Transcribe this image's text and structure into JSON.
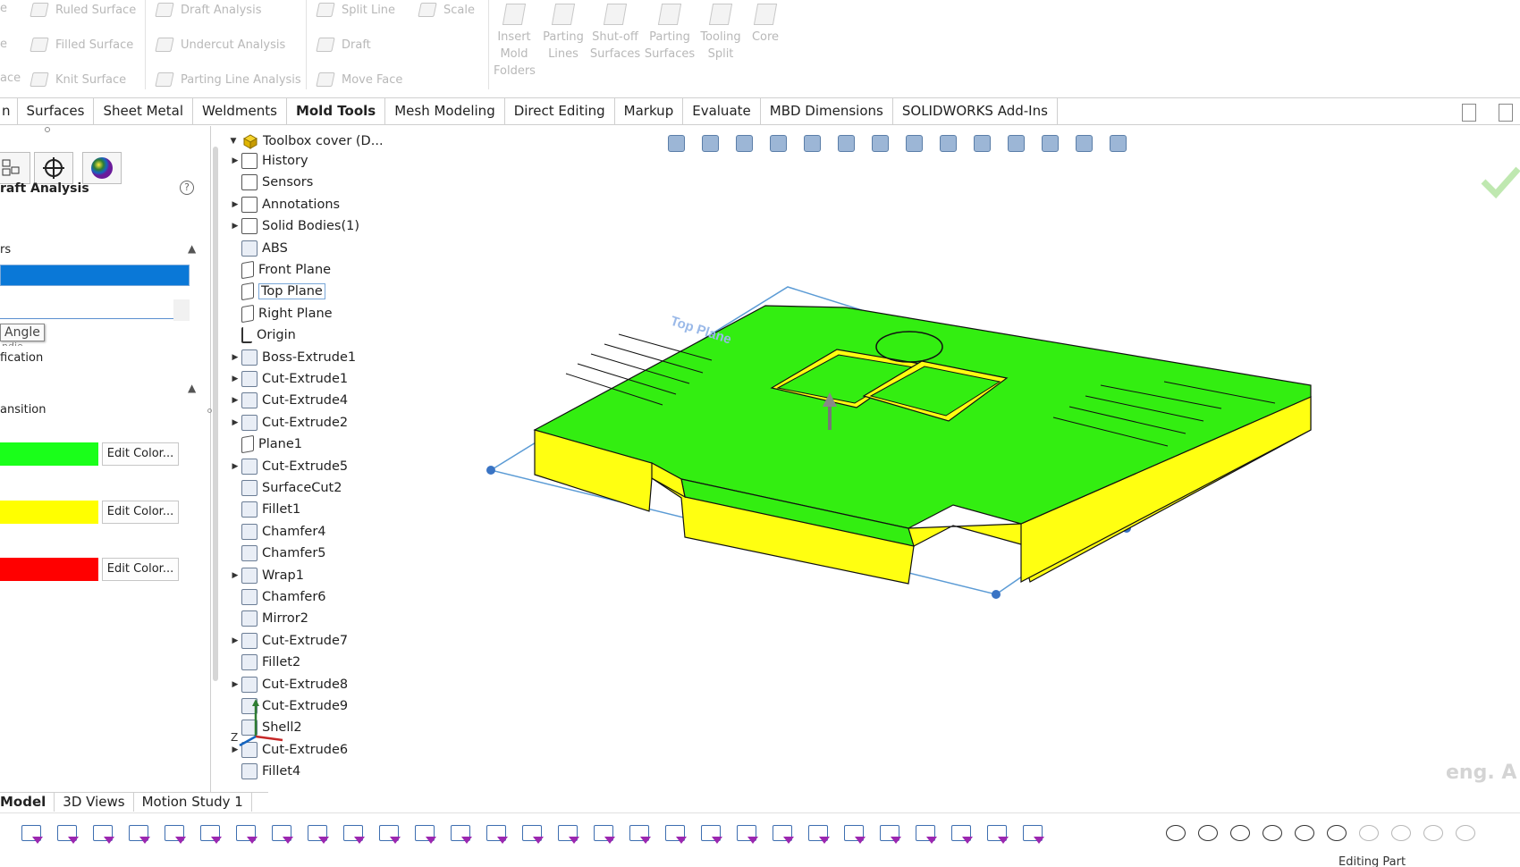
{
  "ribbon": {
    "col1": [
      "Ruled Surface",
      "Filled Surface",
      "Knit Surface"
    ],
    "col0": [
      "e",
      "e",
      "ace"
    ],
    "col2": [
      "Draft Analysis",
      "Undercut Analysis",
      "Parting Line Analysis"
    ],
    "col3": [
      "Split Line",
      "Draft",
      "Move Face"
    ],
    "col3b": "Scale",
    "big": [
      {
        "label": "Insert Mold Folders"
      },
      {
        "label": "Parting Lines"
      },
      {
        "label": "Shut-off Surfaces"
      },
      {
        "label": "Parting Surfaces"
      },
      {
        "label": "Tooling Split"
      },
      {
        "label": "Core"
      }
    ]
  },
  "tabs": [
    "n",
    "Surfaces",
    "Sheet Metal",
    "Weldments",
    "Mold Tools",
    "Mesh Modeling",
    "Direct Editing",
    "Markup",
    "Evaluate",
    "MBD Dimensions",
    "SOLIDWORKS Add-Ins"
  ],
  "active_tab": "Mold Tools",
  "pm": {
    "title": "raft Analysis",
    "help": "?",
    "section1": "rs",
    "angle_label": "Angle",
    "angle_under": "ndie",
    "fication": "fication",
    "transition": "ansition",
    "edit_color": "Edit Color...",
    "colors": {
      "positive": "#1aff1a",
      "negative": "#ffff00",
      "fail": "#ff0000",
      "selection": "#0a78d7"
    }
  },
  "tree": {
    "root": "Toolbox cover (D...",
    "nodes": [
      {
        "label": "History",
        "arrow": true,
        "type": "folder"
      },
      {
        "label": "Sensors",
        "arrow": false,
        "type": "folder"
      },
      {
        "label": "Annotations",
        "arrow": true,
        "type": "folder"
      },
      {
        "label": "Solid Bodies(1)",
        "arrow": true,
        "type": "folder"
      },
      {
        "label": "ABS",
        "arrow": false,
        "type": "feature"
      },
      {
        "label": "Front Plane",
        "arrow": false,
        "type": "plane"
      },
      {
        "label": "Top Plane",
        "arrow": false,
        "type": "plane",
        "selected": true
      },
      {
        "label": "Right Plane",
        "arrow": false,
        "type": "plane"
      },
      {
        "label": "Origin",
        "arrow": false,
        "type": "origin"
      },
      {
        "label": "Boss-Extrude1",
        "arrow": true,
        "type": "feature"
      },
      {
        "label": "Cut-Extrude1",
        "arrow": true,
        "type": "feature"
      },
      {
        "label": "Cut-Extrude4",
        "arrow": true,
        "type": "feature"
      },
      {
        "label": "Cut-Extrude2",
        "arrow": true,
        "type": "feature"
      },
      {
        "label": "Plane1",
        "arrow": false,
        "type": "plane"
      },
      {
        "label": "Cut-Extrude5",
        "arrow": true,
        "type": "feature"
      },
      {
        "label": "SurfaceCut2",
        "arrow": false,
        "type": "feature"
      },
      {
        "label": "Fillet1",
        "arrow": false,
        "type": "feature"
      },
      {
        "label": "Chamfer4",
        "arrow": false,
        "type": "feature"
      },
      {
        "label": "Chamfer5",
        "arrow": false,
        "type": "feature"
      },
      {
        "label": "Wrap1",
        "arrow": true,
        "type": "feature"
      },
      {
        "label": "Chamfer6",
        "arrow": false,
        "type": "feature"
      },
      {
        "label": "Mirror2",
        "arrow": false,
        "type": "feature"
      },
      {
        "label": "Cut-Extrude7",
        "arrow": true,
        "type": "feature"
      },
      {
        "label": "Fillet2",
        "arrow": false,
        "type": "feature"
      },
      {
        "label": "Cut-Extrude8",
        "arrow": true,
        "type": "feature"
      },
      {
        "label": "Cut-Extrude9",
        "arrow": false,
        "type": "feature"
      },
      {
        "label": "Shell2",
        "arrow": false,
        "type": "feature"
      },
      {
        "label": "Cut-Extrude6",
        "arrow": true,
        "type": "feature"
      },
      {
        "label": "Fillet4",
        "arrow": false,
        "type": "feature"
      }
    ]
  },
  "viewport": {
    "plane_label": "Top Plane",
    "model_colors": {
      "top": "#33ee11",
      "side": "#ffff11",
      "edge": "#111111",
      "plane": "#5b9bd5"
    },
    "triad": {
      "z": "Z"
    }
  },
  "bottom_tabs": [
    "Model",
    "3D Views",
    "Motion Study 1"
  ],
  "status": "Editing Part",
  "watermark": "eng. A"
}
